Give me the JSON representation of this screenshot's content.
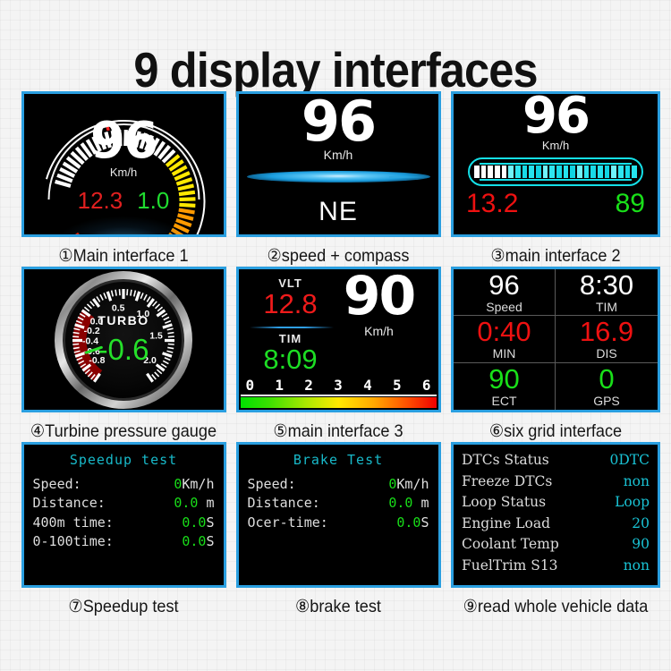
{
  "page": {
    "title": "9 display interfaces",
    "background_color": "#f4f4f4",
    "panel_border_color": "#2a9fe0",
    "screen_background": "#000000"
  },
  "panels": [
    {
      "index": 1,
      "caption": "①Main interface 1",
      "type": "circular-gauge",
      "speed": "96",
      "unit": "Km/h",
      "voltage": "12.3",
      "voltage_color": "#e02020",
      "aux": "1.0",
      "aux_color": "#20dd30",
      "gauge": {
        "tick_count": 58,
        "colors": [
          "#ffffff",
          "#ffe800",
          "#ff9a00",
          "#ff2000"
        ],
        "marker_color": "#ff2020"
      }
    },
    {
      "index": 2,
      "caption": "②speed + compass",
      "type": "speed-compass",
      "speed": "96",
      "unit": "Km/h",
      "direction": "NE",
      "lens_color": "#1c9fe0"
    },
    {
      "index": 3,
      "caption": "③main interface 2",
      "type": "speed-bar",
      "speed": "96",
      "unit": "Km/h",
      "voltage": "13.2",
      "voltage_color": "#ee1111",
      "aux": "89",
      "aux_color": "#19e019",
      "bar": {
        "segment_count": 24,
        "white_segments": 5,
        "fill_color": "#14e0e8",
        "outline_color": "#14e0e8"
      }
    },
    {
      "index": 4,
      "caption": "④Turbine pressure gauge",
      "type": "turbo-gauge",
      "gauge_title": "TURBO",
      "value": "-0.6",
      "value_color": "#25e02a",
      "needle_color": "#25e02a",
      "redzone_color": "#8a0000",
      "scale_labels": [
        "0.5",
        "1.0",
        "1.5",
        "2.0",
        "0.0",
        "-0.2",
        "-0.4",
        "-0.6",
        "-0.8"
      ],
      "range": [
        -1.0,
        2.2
      ]
    },
    {
      "index": 5,
      "caption": "⑤main interface 3",
      "type": "multi-readout",
      "vlt_label": "VLT",
      "vlt_value": "12.8",
      "vlt_color": "#ef1b1b",
      "tim_label": "TIM",
      "tim_value": "8:09",
      "tim_color": "#1ddd24",
      "speed": "90",
      "unit": "Km/h",
      "scale_ticks": [
        "0",
        "1",
        "2",
        "3",
        "4",
        "5",
        "6"
      ]
    },
    {
      "index": 6,
      "caption": "⑥six grid interface",
      "type": "six-grid",
      "cells": [
        {
          "value": "96",
          "label": "Speed",
          "color": "#ffffff"
        },
        {
          "value": "8:30",
          "label": "TIM",
          "color": "#ffffff"
        },
        {
          "value": "0:40",
          "label": "MIN",
          "color": "#ee1111"
        },
        {
          "value": "16.9",
          "label": "DIS",
          "color": "#ee1111"
        },
        {
          "value": "90",
          "label": "ECT",
          "color": "#19e019"
        },
        {
          "value": "0",
          "label": "GPS",
          "color": "#19e019"
        }
      ]
    },
    {
      "index": 7,
      "caption": "⑦Speedup test",
      "type": "text-readout",
      "screen_title": "Speedup test",
      "title_color": "#18b9c9",
      "rows": [
        {
          "label": "Speed:",
          "value": "0",
          "unit": "Km/h"
        },
        {
          "label": "Distance:",
          "value": "0.0",
          "unit": " m"
        },
        {
          "label": "400m time:",
          "value": "0.0",
          "unit": "S"
        },
        {
          "label": "0-100time:",
          "value": "0.0",
          "unit": "S"
        }
      ]
    },
    {
      "index": 8,
      "caption": "⑧brake test",
      "type": "text-readout",
      "screen_title": "Brake Test",
      "title_color": "#18b9c9",
      "rows": [
        {
          "label": "Speed:",
          "value": "0",
          "unit": "Km/h"
        },
        {
          "label": "Distance:",
          "value": "0.0",
          "unit": " m"
        },
        {
          "label": "Ocer-time:",
          "value": "0.0",
          "unit": "S"
        }
      ]
    },
    {
      "index": 9,
      "caption": "⑨read whole vehicle data",
      "type": "data-list",
      "rows": [
        {
          "label": "DTCs Status",
          "value": "0DTC"
        },
        {
          "label": "Freeze DTCs",
          "value": "non"
        },
        {
          "label": "Loop Status",
          "value": "Loop"
        },
        {
          "label": "Engine Load",
          "value": "20"
        },
        {
          "label": "Coolant Temp",
          "value": "90"
        },
        {
          "label": "FuelTrim S13",
          "value": "non"
        }
      ]
    }
  ]
}
